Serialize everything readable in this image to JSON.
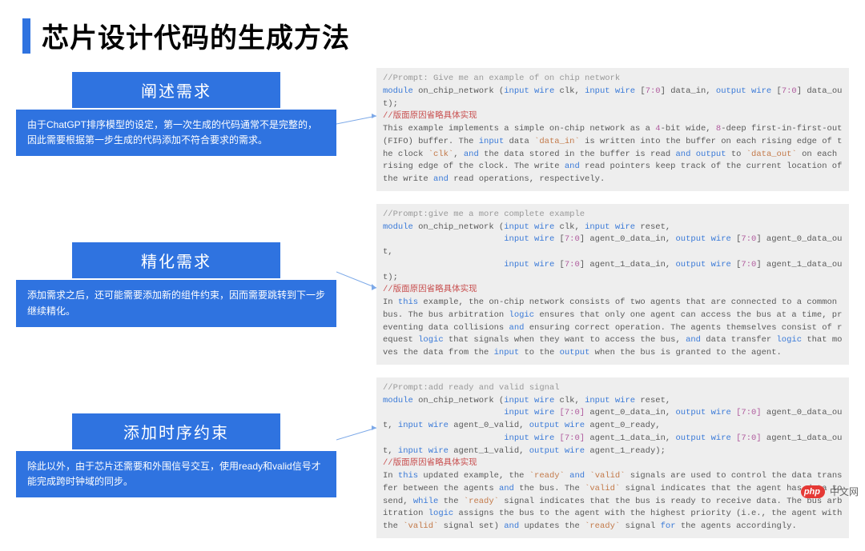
{
  "title": "芯片设计代码的生成方法",
  "steps": [
    {
      "header": "阐述需求",
      "body": "由于ChatGPT排序模型的设定，第一次生成的代码通常不是完整的，因此需要根据第一步生成的代码添加不符合要求的需求。"
    },
    {
      "header": "精化需求",
      "body": "添加需求之后，还可能需要添加新的组件约束，因而需要跳转到下一步继续精化。"
    },
    {
      "header": "添加时序约束",
      "body": "除此以外，由于芯片还需要和外围信号交互，使用ready和valid信号才能完成跨时钟域的同步。"
    }
  ],
  "code_blocks": [
    {
      "prompt": "//Prompt: Give me an example of on chip network",
      "decl_prefix": "module",
      "decl_name": " on_chip_network (",
      "sig1": "input wire",
      "sig1b": " clk, ",
      "sig2": "input wire",
      "sig2b": " [",
      "sig2n": "7:0",
      "sig2c": "] data_in, ",
      "sig3": "output wire",
      "sig3b": " [",
      "sig3n": "7:0",
      "sig3c": "] data_out);",
      "omit": "//版面原因省略具体实现",
      "expl_pre": "This example implements a simple on-chip network as a ",
      "expl_num1": "4",
      "expl_mid1": "-bit wide, ",
      "expl_num2": "8",
      "expl_mid2": "-deep first-in-first-out (FIFO) buffer. The ",
      "kw_input": "input",
      "expl_mid3": " data ",
      "tick_din": "`data_in`",
      "expl_mid4": " is written into the buffer on each rising edge of the clock ",
      "tick_clk": "`clk`",
      "expl_mid5": ", ",
      "kw_and1": "and",
      "expl_mid6": " the data stored in the buffer is read ",
      "kw_and2": "and",
      "expl_mid7": " ",
      "kw_output": "output",
      "expl_mid8": " to ",
      "tick_dout": "`data_out`",
      "expl_mid9": " on each rising edge of the clock. The write ",
      "kw_and3": "and",
      "expl_mid10": " read pointers keep track of the current location of the write ",
      "kw_and4": "and",
      "expl_end": " read operations, respectively."
    },
    {
      "prompt": "//Prompt:give me a more complete example",
      "l1a": "module",
      "l1b": " on_chip_network (",
      "l1c": "input wire",
      "l1d": " clk, ",
      "l1e": "input wire",
      "l1f": " reset,",
      "l2pad": "                        ",
      "l2a": "input wire",
      "l2b": " [",
      "l2n": "7:0",
      "l2c": "] agent_0_data_in, ",
      "l2d": "output wire",
      "l2e": " [",
      "l2n2": "7:0",
      "l2f": "] agent_0_data_out,",
      "l3pad": "                        ",
      "l3a": "input wire",
      "l3b": " [",
      "l3n": "7:0",
      "l3c": "] agent_1_data_in, ",
      "l3d": "output wire",
      "l3e": " [",
      "l3n2": "7:0",
      "l3f": "] agent_1_data_out);",
      "omit": "//版面原因省略具体实现",
      "e1": "In ",
      "kw_this": "this",
      "e2": " example, the on-chip network consists of two agents that are connected to a common bus. The bus arbitration ",
      "kw_logic": "logic",
      "e3": " ensures that only one agent can access the bus at a time, preventing data collisions ",
      "kw_and1": "and",
      "e4": " ensuring correct operation. The agents themselves consist of request ",
      "kw_logic2": "logic",
      "e5": " that signals when they want to access the bus, ",
      "kw_and2": "and",
      "e6": " data transfer ",
      "kw_logic3": "logic",
      "e7": " that moves the data from the ",
      "kw_input": "input",
      "e8": " to the ",
      "kw_output": "output",
      "e9": " when the bus is granted to the agent."
    },
    {
      "prompt": "//Prompt:add ready and valid signal",
      "h1": "module",
      "h1b": " on_chip_network (",
      "h1c": "input wire",
      "h1d": " clk, ",
      "h1e": "input wire",
      "h1f": " reset,",
      "l2pad": "                        ",
      "l2a": "input wire",
      "l2an": " [7:0]",
      "l2at": " agent_0_data_in, ",
      "l2b": "output wire",
      "l2bn": " [7:0]",
      "l2bt": " agent_0_data_out, ",
      "l2c": "input wire",
      "l2ct": " agent_0_valid, ",
      "l2d": "output wire",
      "l2dt": " agent_0_ready,",
      "l3pad": "                        ",
      "l3a": "input wire",
      "l3an": " [7:0]",
      "l3at": " agent_1_data_in, ",
      "l3b": "output wire",
      "l3bn": " [7:0]",
      "l3bt": " agent_1_data_out, ",
      "l3c": "input wire",
      "l3ct": " agent_1_valid, ",
      "l3d": "output wire",
      "l3dt": " agent_1_ready);",
      "omit": "//版面原因省略具体实现",
      "e1": "In ",
      "kw_this": "this",
      "e2": " updated example, the ",
      "tick_ready": "`ready`",
      "e3": " ",
      "kw_and1": "and",
      "e4": " ",
      "tick_valid": "`valid`",
      "e5": " signals are used to control the data transfer between the agents ",
      "kw_and2": "and",
      "e6": " the bus. The ",
      "tick_valid2": "`valid`",
      "e7": " signal indicates that the agent has data to send, ",
      "kw_while": "while",
      "e8": " the ",
      "tick_ready2": "`ready`",
      "e9": " signal indicates that the bus is ready to receive data. The bus arbitration ",
      "kw_logic": "logic",
      "e10": " assigns the bus to the agent with the highest priority (i.e., the agent with the ",
      "tick_valid3": "`valid`",
      "e11": " signal set) ",
      "kw_and3": "and",
      "e12": " updates the ",
      "tick_ready3": "`ready`",
      "e13": " signal ",
      "kw_for": "for",
      "e14": " the agents accordingly."
    }
  ],
  "watermark": {
    "badge": "php",
    "text": "中文网"
  }
}
